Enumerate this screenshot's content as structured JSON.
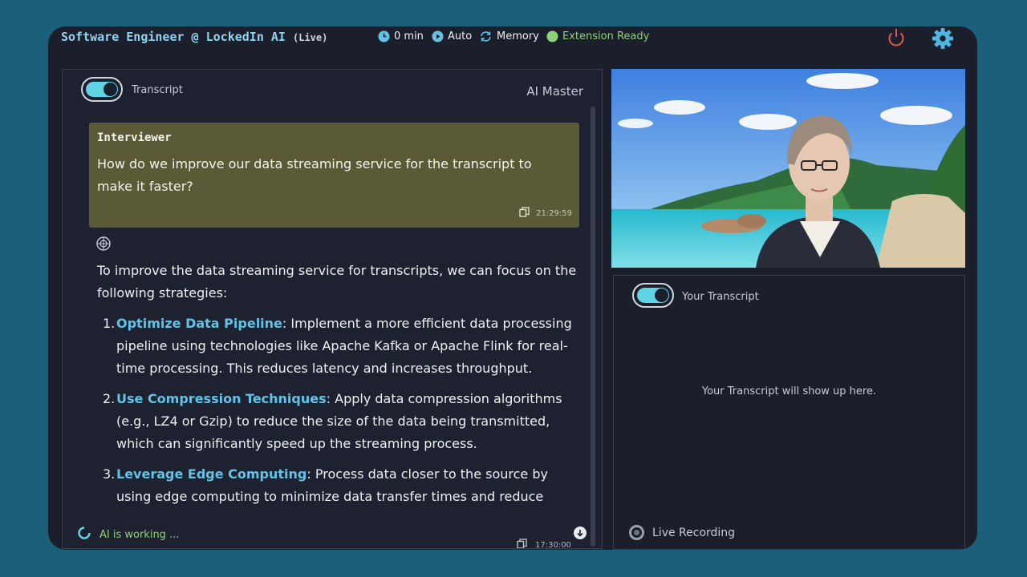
{
  "header": {
    "title": "Software Engineer @ LockedIn AI",
    "live_tag": "(Live)",
    "timer": "0 min",
    "mode": "Auto",
    "memory": "Memory",
    "extension_status": "Extension Ready",
    "icons": [
      "clock-icon",
      "play-icon",
      "sync-icon",
      "status-dot-icon",
      "power-icon",
      "gear-icon"
    ],
    "colors": {
      "title": "#8fd3ef",
      "status_ok": "#8fd07a",
      "power": "#e0584d",
      "gear": "#4fb6e0"
    }
  },
  "left_panel": {
    "toggle_label": "Transcript",
    "toggle_on": true,
    "ai_master": "AI Master",
    "message": {
      "speaker": "Interviewer",
      "text": "How do we improve our data streaming service for the transcript to make it faster?",
      "time": "21:29:59"
    },
    "answer": {
      "intro": "To improve the data streaming service for transcripts, we can focus on the following strategies:",
      "items": [
        {
          "num": "1.",
          "title": "Optimize Data Pipeline",
          "text": ": Implement a more efficient data processing pipeline using technologies like Apache Kafka or Apache Flink for real-time processing. This reduces latency and increases throughput."
        },
        {
          "num": "2.",
          "title": "Use Compression Techniques",
          "text": ": Apply data compression algorithms (e.g., LZ4 or Gzip) to reduce the size of the data being transmitted, which can significantly speed up the streaming process."
        },
        {
          "num": "3.",
          "title": "Leverage Edge Computing",
          "text": ": Process data closer to the source by using edge computing to minimize data transfer times and reduce"
        }
      ],
      "time": "17:30:00"
    },
    "working_status": "AI is working ..."
  },
  "right_panel": {
    "toggle_label": "Your Transcript",
    "toggle_on": true,
    "placeholder": "Your Transcript will show up here.",
    "recording_label": "Live Recording"
  }
}
